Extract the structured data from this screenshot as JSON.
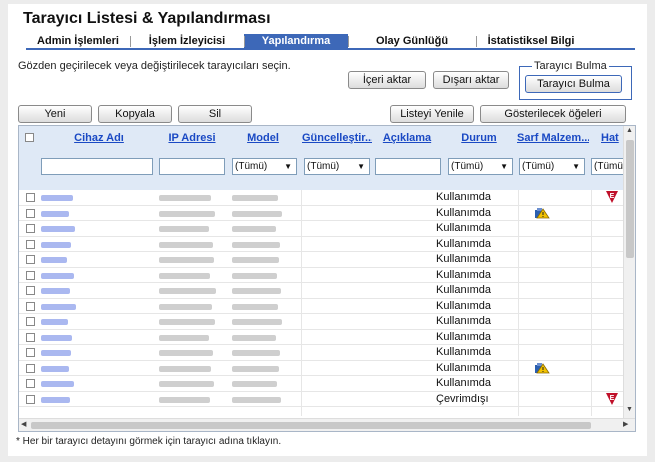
{
  "page": {
    "title": "Tarayıcı Listesi & Yapılandırması"
  },
  "tabs": [
    {
      "label": "Admin İşlemleri",
      "active": false
    },
    {
      "label": "İşlem İzleyicisi",
      "active": false
    },
    {
      "label": "Yapılandırma Listesi",
      "active": true
    },
    {
      "label": "Olay Günlüğü",
      "active": false
    },
    {
      "label": "İstatistiksel Bilgi",
      "active": false
    }
  ],
  "instructions": "Gözden geçirilecek veya değiştirilecek tarayıcıları seçin.",
  "buttons": {
    "import": "İçeri aktar",
    "export": "Dışarı aktar",
    "finder_group": "Tarayıcı Bulma",
    "finder": "Tarayıcı Bulma",
    "new": "Yeni",
    "copy": "Kopyala",
    "delete": "Sil",
    "refresh": "Listeyi Yenile",
    "edit_columns": "Gösterilecek öğeleri düzenleme"
  },
  "table": {
    "columns": [
      "Cihaz Adı",
      "IP Adresi",
      "Model",
      "Güncelleştir...",
      "Açıklama",
      "Durum",
      "Sarf Malzem...",
      "Hat"
    ],
    "filter_all": "(Tümü)",
    "rows": [
      {
        "status": "Kullanımda",
        "supply": false,
        "error": true
      },
      {
        "status": "Kullanımda",
        "supply": true,
        "error": false
      },
      {
        "status": "Kullanımda",
        "supply": false,
        "error": false
      },
      {
        "status": "Kullanımda",
        "supply": false,
        "error": false
      },
      {
        "status": "Kullanımda",
        "supply": false,
        "error": false
      },
      {
        "status": "Kullanımda",
        "supply": false,
        "error": false
      },
      {
        "status": "Kullanımda",
        "supply": false,
        "error": false
      },
      {
        "status": "Kullanımda",
        "supply": false,
        "error": false
      },
      {
        "status": "Kullanımda",
        "supply": false,
        "error": false
      },
      {
        "status": "Kullanımda",
        "supply": false,
        "error": false
      },
      {
        "status": "Kullanımda",
        "supply": false,
        "error": false
      },
      {
        "status": "Kullanımda",
        "supply": true,
        "error": false
      },
      {
        "status": "Kullanımda",
        "supply": false,
        "error": false
      },
      {
        "status": "Çevrimdışı",
        "supply": false,
        "error": true
      }
    ]
  },
  "footer": "* Her bir tarayıcı detayını görmek için tarayıcı adına tıklayın.",
  "colors": {
    "accent": "#3d68b8",
    "link": "#1a49c4",
    "header_bg": "#dfe9f6",
    "error": "#c0102a"
  }
}
